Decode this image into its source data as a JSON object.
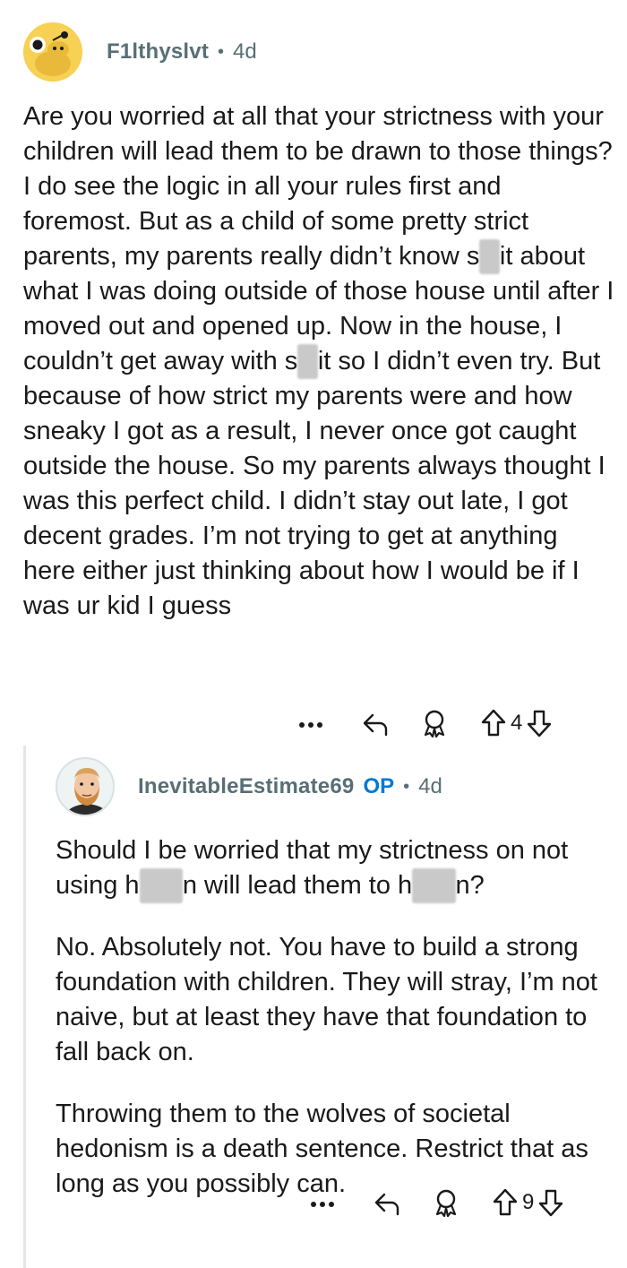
{
  "comments": [
    {
      "username": "F1lthyslvt",
      "separator": "•",
      "age": "4d",
      "avatar_icon": "snoo-avatar-icon",
      "paragraphs": [
        "Are you worried at all that your strictness with your children will lead them to be drawn to those things? I do see the logic in all your rules first and foremost. But as a child of some pretty strict parents, my parents really didn’t know s  it about what I was doing outside of those house until after I moved out and opened up. Now in the house, I couldn’t get away with s  it so I didn’t even try. But because of how strict my parents were and how sneaky I got as a result, I never once got caught outside the house. So my parents always thought I was this perfect child. I didn’t stay out late, I got decent grades. I’m not trying to get at anything here either just thinking about how I would be if I was ur kid I guess"
      ],
      "votes": "4"
    },
    {
      "username": "InevitableEstimate69",
      "op_badge": "OP",
      "separator": "•",
      "age": "4d",
      "avatar_icon": "bearded-man-avatar-icon",
      "paragraphs": [
        "Should I be worried that my strictness on not using h      n will lead them to h      n?",
        "No. Absolutely not. You have to build a strong foundation with children. They will stray, I’m not naive, but at least they have that foundation to fall back on.",
        "Throwing them to the wolves of societal hedonism is a death sentence. Restrict that as long as you possibly can."
      ],
      "votes": "9"
    }
  ],
  "colors": {
    "meta_text": "#576f76",
    "op_blue": "#0079d3",
    "snoo_yellow": "#f7d154",
    "body_text": "#1a1a1b",
    "thread_line": "#e5e5e5"
  },
  "icons": [
    "more-icon",
    "reply-icon",
    "award-icon",
    "upvote-icon",
    "downvote-icon"
  ]
}
